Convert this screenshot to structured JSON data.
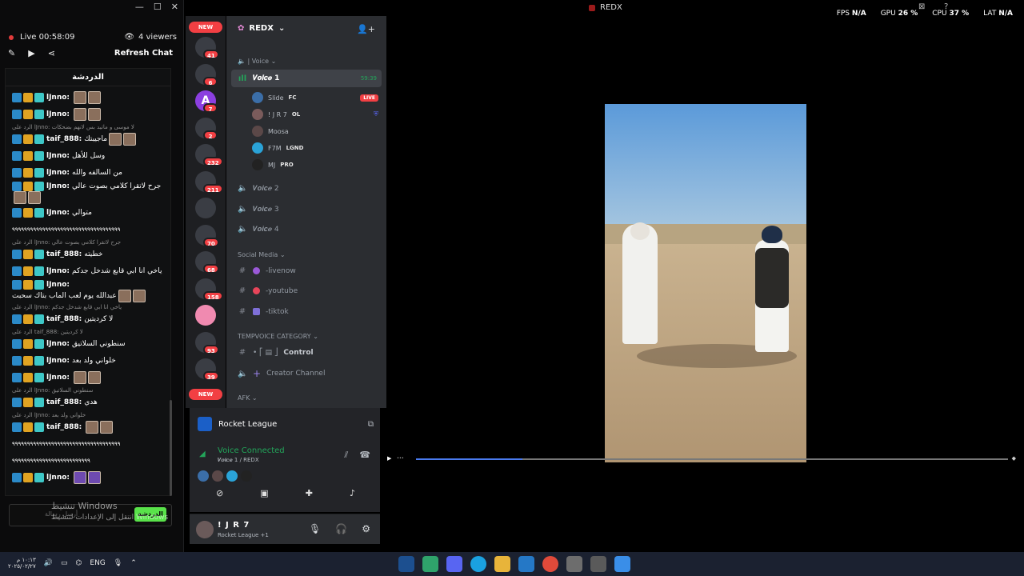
{
  "chat": {
    "live_label": "Live",
    "live_time": "00:58:09",
    "viewers": "4 viewers",
    "refresh": "Refresh Chat",
    "panel_title": "الدردشة",
    "input_placeholder": "أرسل رسالة",
    "send_label": "الدردشة",
    "watermark_line1": "تنشيط Windows",
    "watermark_line2": "انتقل إلى الإعدادات لتنشيط Windows",
    "messages": [
      {
        "user": "lJnno:",
        "text": ""
      },
      {
        "user": "lJnno:",
        "text": ""
      },
      {
        "reply": "الرد على lJnno: لا موسى و ماتيد بس لانهم بضحكات"
      },
      {
        "user": "taif_888:",
        "text": "ماجيبتك"
      },
      {
        "user": "lJnno:",
        "text": "وسل للأهل"
      },
      {
        "user": "lJnno:",
        "text": "من السالفه والله"
      },
      {
        "user": "lJnno:",
        "text": "جرح لاتقرا كلامي بصوت عالي"
      },
      {
        "user": "lJnno:",
        "text": "متوالي"
      },
      {
        "dash": "٩٩٩٩٩٩٩٩٩٩٩٩٩٩٩٩٩٩٩٩٩٩٩٩٩٩٩٩٩٩٩٩٩٩٩٩"
      },
      {
        "reply": "الرد على lJnno: جرح لاتقرا كلامي بصوت عالي"
      },
      {
        "user": "taif_888:",
        "text": "خطيته"
      },
      {
        "user": "lJnno:",
        "text": "ياخي انا ابي قابع شدخل جدكم"
      },
      {
        "user": "lJnno:",
        "text": "عبدالله يوم لعب الماب بتاك سحبت"
      },
      {
        "reply": "الرد على lJnno: ياخي انا ابي قابع شدخل جدكم"
      },
      {
        "user": "taif_888:",
        "text": "لا كرديتين"
      },
      {
        "reply": "الرد على taif_888: لا كرديتين"
      },
      {
        "user": "lJnno:",
        "text": "سنطوني السلاتيق"
      },
      {
        "user": "lJnno:",
        "text": "خلواني ولد بعد"
      },
      {
        "user": "lJnno:",
        "text": ""
      },
      {
        "reply": "الرد على lJnno: سنطوني السلاتيق"
      },
      {
        "user": "taif_888:",
        "text": "هدي"
      },
      {
        "reply": "الرد على lJnno: خلواني ولد بعد"
      },
      {
        "user": "taif_888:",
        "text": ""
      },
      {
        "dash": "٩٩٩٩٩٩٩٩٩٩٩٩٩٩٩٩٩٩٩٩٩٩٩٩٩٩٩٩٩٩٩٩٩٩٩٩"
      },
      {
        "dash": "٩٩٩٩٩٩٩٩٩٩٩٩٩٩٩٩٩٩٩٩٩٩٩٩٩٩"
      },
      {
        "user": "lJnno:",
        "text": ""
      }
    ]
  },
  "discord": {
    "server_name": "REDX",
    "rail": [
      {
        "badge": "NEW"
      },
      {
        "badge": "41"
      },
      {
        "badge": "6"
      },
      {
        "label": "A",
        "badge": "7"
      },
      {
        "badge": "2"
      },
      {
        "badge": "232"
      },
      {
        "badge": "211"
      },
      {
        "badge": ""
      },
      {
        "badge": "70"
      },
      {
        "badge": "68"
      },
      {
        "badge": "158"
      },
      {
        "badge": ""
      },
      {
        "badge": "93"
      },
      {
        "badge": "39"
      },
      {
        "badge": "NEW"
      }
    ],
    "voice_category": "| Voice",
    "active_channel": "𝑽𝒐𝒊𝒄𝒆 1",
    "active_time": "59:39",
    "live_tag": "LIVE",
    "members": [
      {
        "name": "Slide",
        "tag": "FC"
      },
      {
        "name": "! J R 7",
        "tag": "OL"
      },
      {
        "name": "Moosa",
        "tag": ""
      },
      {
        "name": "F7M",
        "tag": "LGND"
      },
      {
        "name": "MJ",
        "tag": "PRO"
      }
    ],
    "voice_channels": [
      "𝑽𝒐𝒊𝒄𝒆 2",
      "𝑽𝒐𝒊𝒄𝒆 3",
      "𝑽𝒐𝒊𝒄𝒆 4"
    ],
    "social_category": "Social Media",
    "social_channels": [
      "-livenow",
      "-youtube",
      "-tiktok"
    ],
    "temp_category": "TEMPVOICE CATEGORY",
    "control_channel": "Control",
    "creator_channel": "Creator Channel",
    "afk_category": "AFK",
    "game": "Rocket League",
    "voice_connected": "Voice Connected",
    "voice_sub": "𝑽𝒐𝒊𝒄𝒆 1 / REDX",
    "user_name": "! J R 7",
    "user_status": "Rocket League +1"
  },
  "stream": {
    "window_title": "REDX",
    "fps_label": "FPS",
    "fps": "N/A",
    "gpu_label": "GPU",
    "gpu": "26 %",
    "cpu_label": "CPU",
    "cpu": "37 %",
    "lat_label": "LAT",
    "lat": "N/A",
    "progress": 0.18
  },
  "taskbar": {
    "lang": "ENG",
    "time": "١٠:١٣ م",
    "date": "٢٠٢٥/٠٢/٢٧"
  }
}
